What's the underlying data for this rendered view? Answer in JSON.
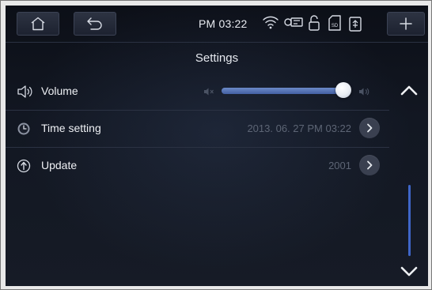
{
  "status_bar": {
    "time": "PM 03:22",
    "icons": [
      "home-icon",
      "back-icon",
      "wifi-icon",
      "key-icon",
      "unlock-icon",
      "sd-card-icon",
      "usb-icon",
      "plus-icon"
    ]
  },
  "page": {
    "title": "Settings"
  },
  "rows": [
    {
      "label": "Volume",
      "icon": "speaker-icon",
      "volume_level": 0.95
    },
    {
      "label": "Time setting",
      "icon": "clock-icon",
      "value": "2013. 06. 27 PM 03:22"
    },
    {
      "label": "Update",
      "icon": "update-icon",
      "value": "2001"
    }
  ],
  "scroll": {
    "up_icon": "chevron-up-icon",
    "down_icon": "chevron-down-icon"
  },
  "colors": {
    "accent": "#4a66ad",
    "background": "#121722",
    "scroll_thumb": "#3f66c8"
  }
}
